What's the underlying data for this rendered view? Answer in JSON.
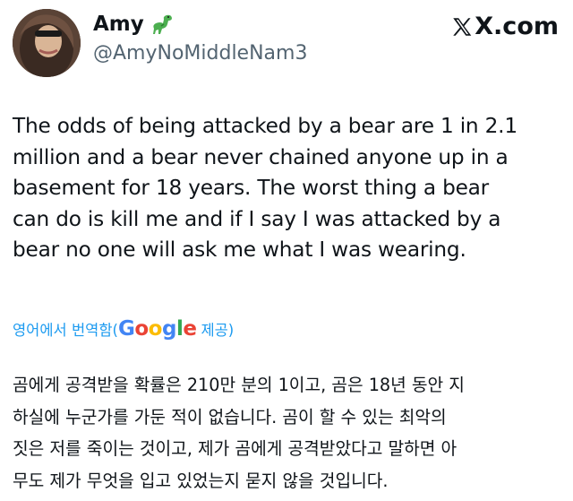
{
  "author": {
    "name": "Amy",
    "emoji_icon": "dinosaur-icon",
    "handle": "@AmyNoMiddleNam3"
  },
  "source": {
    "brand": "X.com",
    "logo_icon": "x-logo-icon"
  },
  "tweet": {
    "lines": [
      "The odds of being attacked by a bear are 1 in 2.1",
      "million and a bear never chained anyone up in a",
      "basement for 18 years. The worst thing a bear",
      "can do is kill me and if I say I was attacked by a",
      "bear no one will ask me what I was wearing."
    ]
  },
  "translation_meta": {
    "prefix": "영어에서 번역함(",
    "google": [
      "G",
      "o",
      "o",
      "g",
      "l",
      "e"
    ],
    "suffix": " 제공)",
    "link_color": "#1d9bf0"
  },
  "translation": {
    "lines": [
      "곰에게 공격받을 확률은 210만 분의 1이고, 곰은 18년 동안 지",
      "하실에 누군가를 가둔 적이 없습니다. 곰이 할 수 있는 최악의",
      "짓은 저를 죽이는 것이고, 제가 곰에게 공격받았다고 말하면 아",
      "무도 제가 무엇을 입고 있었는지 묻지 않을 것입니다."
    ]
  }
}
